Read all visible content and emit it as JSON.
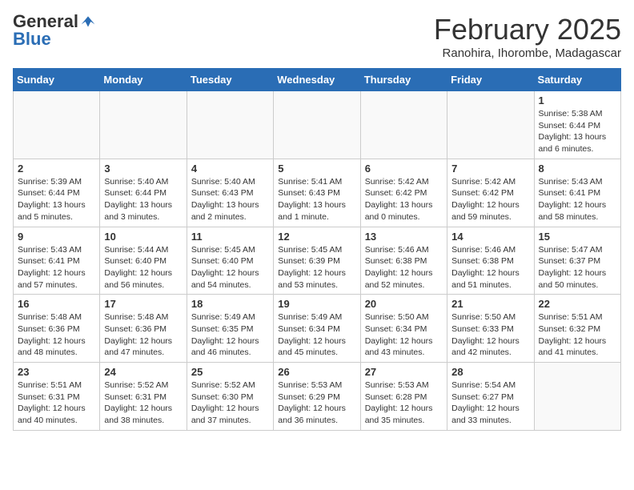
{
  "header": {
    "logo_general": "General",
    "logo_blue": "Blue",
    "month_title": "February 2025",
    "subtitle": "Ranohira, Ihorombe, Madagascar"
  },
  "weekdays": [
    "Sunday",
    "Monday",
    "Tuesday",
    "Wednesday",
    "Thursday",
    "Friday",
    "Saturday"
  ],
  "weeks": [
    [
      {
        "day": "",
        "info": ""
      },
      {
        "day": "",
        "info": ""
      },
      {
        "day": "",
        "info": ""
      },
      {
        "day": "",
        "info": ""
      },
      {
        "day": "",
        "info": ""
      },
      {
        "day": "",
        "info": ""
      },
      {
        "day": "1",
        "info": "Sunrise: 5:38 AM\nSunset: 6:44 PM\nDaylight: 13 hours\nand 6 minutes."
      }
    ],
    [
      {
        "day": "2",
        "info": "Sunrise: 5:39 AM\nSunset: 6:44 PM\nDaylight: 13 hours\nand 5 minutes."
      },
      {
        "day": "3",
        "info": "Sunrise: 5:40 AM\nSunset: 6:44 PM\nDaylight: 13 hours\nand 3 minutes."
      },
      {
        "day": "4",
        "info": "Sunrise: 5:40 AM\nSunset: 6:43 PM\nDaylight: 13 hours\nand 2 minutes."
      },
      {
        "day": "5",
        "info": "Sunrise: 5:41 AM\nSunset: 6:43 PM\nDaylight: 13 hours\nand 1 minute."
      },
      {
        "day": "6",
        "info": "Sunrise: 5:42 AM\nSunset: 6:42 PM\nDaylight: 13 hours\nand 0 minutes."
      },
      {
        "day": "7",
        "info": "Sunrise: 5:42 AM\nSunset: 6:42 PM\nDaylight: 12 hours\nand 59 minutes."
      },
      {
        "day": "8",
        "info": "Sunrise: 5:43 AM\nSunset: 6:41 PM\nDaylight: 12 hours\nand 58 minutes."
      }
    ],
    [
      {
        "day": "9",
        "info": "Sunrise: 5:43 AM\nSunset: 6:41 PM\nDaylight: 12 hours\nand 57 minutes."
      },
      {
        "day": "10",
        "info": "Sunrise: 5:44 AM\nSunset: 6:40 PM\nDaylight: 12 hours\nand 56 minutes."
      },
      {
        "day": "11",
        "info": "Sunrise: 5:45 AM\nSunset: 6:40 PM\nDaylight: 12 hours\nand 54 minutes."
      },
      {
        "day": "12",
        "info": "Sunrise: 5:45 AM\nSunset: 6:39 PM\nDaylight: 12 hours\nand 53 minutes."
      },
      {
        "day": "13",
        "info": "Sunrise: 5:46 AM\nSunset: 6:38 PM\nDaylight: 12 hours\nand 52 minutes."
      },
      {
        "day": "14",
        "info": "Sunrise: 5:46 AM\nSunset: 6:38 PM\nDaylight: 12 hours\nand 51 minutes."
      },
      {
        "day": "15",
        "info": "Sunrise: 5:47 AM\nSunset: 6:37 PM\nDaylight: 12 hours\nand 50 minutes."
      }
    ],
    [
      {
        "day": "16",
        "info": "Sunrise: 5:48 AM\nSunset: 6:36 PM\nDaylight: 12 hours\nand 48 minutes."
      },
      {
        "day": "17",
        "info": "Sunrise: 5:48 AM\nSunset: 6:36 PM\nDaylight: 12 hours\nand 47 minutes."
      },
      {
        "day": "18",
        "info": "Sunrise: 5:49 AM\nSunset: 6:35 PM\nDaylight: 12 hours\nand 46 minutes."
      },
      {
        "day": "19",
        "info": "Sunrise: 5:49 AM\nSunset: 6:34 PM\nDaylight: 12 hours\nand 45 minutes."
      },
      {
        "day": "20",
        "info": "Sunrise: 5:50 AM\nSunset: 6:34 PM\nDaylight: 12 hours\nand 43 minutes."
      },
      {
        "day": "21",
        "info": "Sunrise: 5:50 AM\nSunset: 6:33 PM\nDaylight: 12 hours\nand 42 minutes."
      },
      {
        "day": "22",
        "info": "Sunrise: 5:51 AM\nSunset: 6:32 PM\nDaylight: 12 hours\nand 41 minutes."
      }
    ],
    [
      {
        "day": "23",
        "info": "Sunrise: 5:51 AM\nSunset: 6:31 PM\nDaylight: 12 hours\nand 40 minutes."
      },
      {
        "day": "24",
        "info": "Sunrise: 5:52 AM\nSunset: 6:31 PM\nDaylight: 12 hours\nand 38 minutes."
      },
      {
        "day": "25",
        "info": "Sunrise: 5:52 AM\nSunset: 6:30 PM\nDaylight: 12 hours\nand 37 minutes."
      },
      {
        "day": "26",
        "info": "Sunrise: 5:53 AM\nSunset: 6:29 PM\nDaylight: 12 hours\nand 36 minutes."
      },
      {
        "day": "27",
        "info": "Sunrise: 5:53 AM\nSunset: 6:28 PM\nDaylight: 12 hours\nand 35 minutes."
      },
      {
        "day": "28",
        "info": "Sunrise: 5:54 AM\nSunset: 6:27 PM\nDaylight: 12 hours\nand 33 minutes."
      },
      {
        "day": "",
        "info": ""
      }
    ]
  ]
}
